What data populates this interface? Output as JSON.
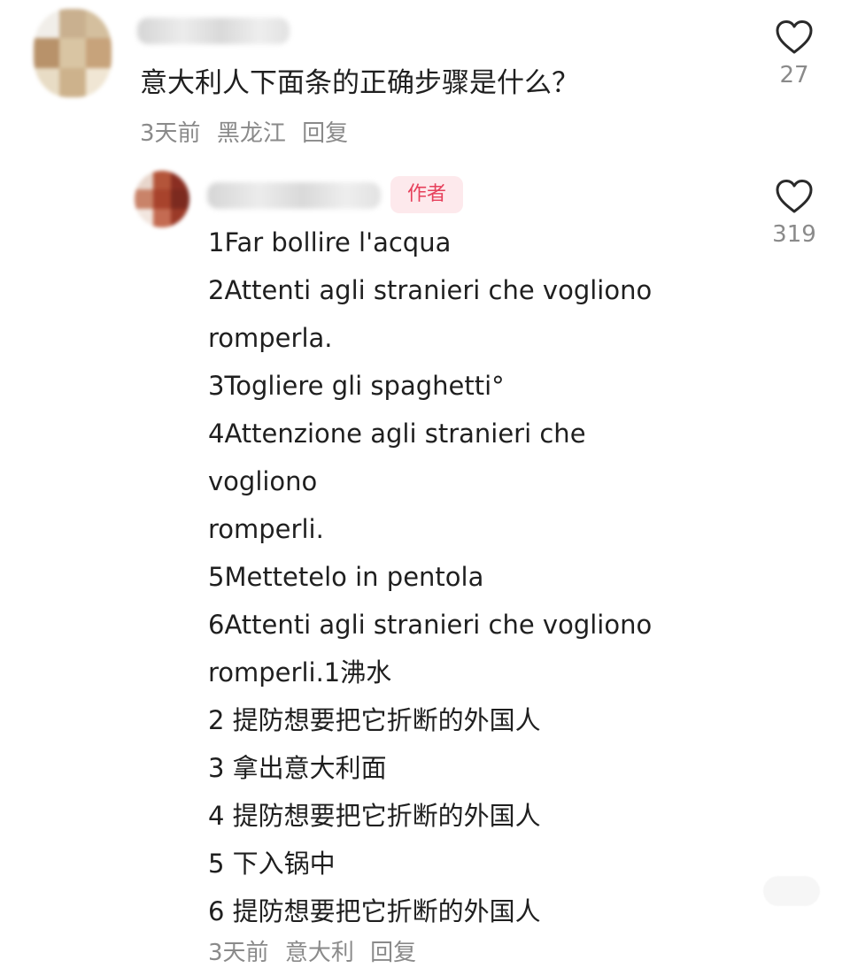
{
  "top_comment": {
    "text": "意大利人下面条的正确步骤是什么？",
    "time": "3天前",
    "location": "黑龙江",
    "reply_label": "回复",
    "like_icon": "heart-outline-icon",
    "likes": "27"
  },
  "author_reply": {
    "badge": "作者",
    "like_icon": "heart-outline-icon",
    "likes": "319",
    "lines": [
      "1Far bollire l'acqua",
      "2Attenti agli stranieri che vogliono",
      "romperla.",
      "3Togliere gli spaghetti°",
      "4Attenzione agli stranieri che",
      "vogliono",
      "romperli.",
      "5Mettetelo in pentola",
      "6Attenti agli stranieri che vogliono",
      "romperli.1沸水",
      "2 提防想要把它折断的外国人",
      "3 拿出意大利面",
      "4 提防想要把它折断的外国人",
      "5 下入锅中",
      "6 提防想要把它折断的外国人"
    ],
    "time": "3天前",
    "location": "意大利",
    "reply_label": "回复"
  },
  "colors": {
    "text": "#1f1f1f",
    "meta": "#8a8a8a",
    "badge_bg": "#fde9ec",
    "badge_text": "#e6405b"
  }
}
